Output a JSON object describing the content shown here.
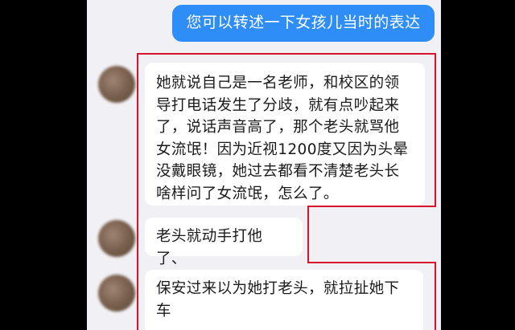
{
  "messages": {
    "outgoing": {
      "text": "您可以转述一下女孩儿当时的表达"
    },
    "incoming": [
      {
        "text": "她就说自己是一名老师，和校区的领导打电话发生了分歧，就有点吵起来了，说话声音高了，那个老头就骂他女流氓！因为近视1200度又因为头晕没戴眼镜，她过去都看不清楚老头长啥样问了女流氓，怎么了。"
      },
      {
        "text": "老头就动手打他了、"
      },
      {
        "text": "保安过来以为她打老头，就拉扯她下车"
      }
    ]
  },
  "colors": {
    "chat_background": "#f1f0f4",
    "outgoing_bubble": "#2f8df7",
    "incoming_bubble": "#ffffff",
    "highlight_border": "#d6152a",
    "frame_background": "#000000"
  }
}
